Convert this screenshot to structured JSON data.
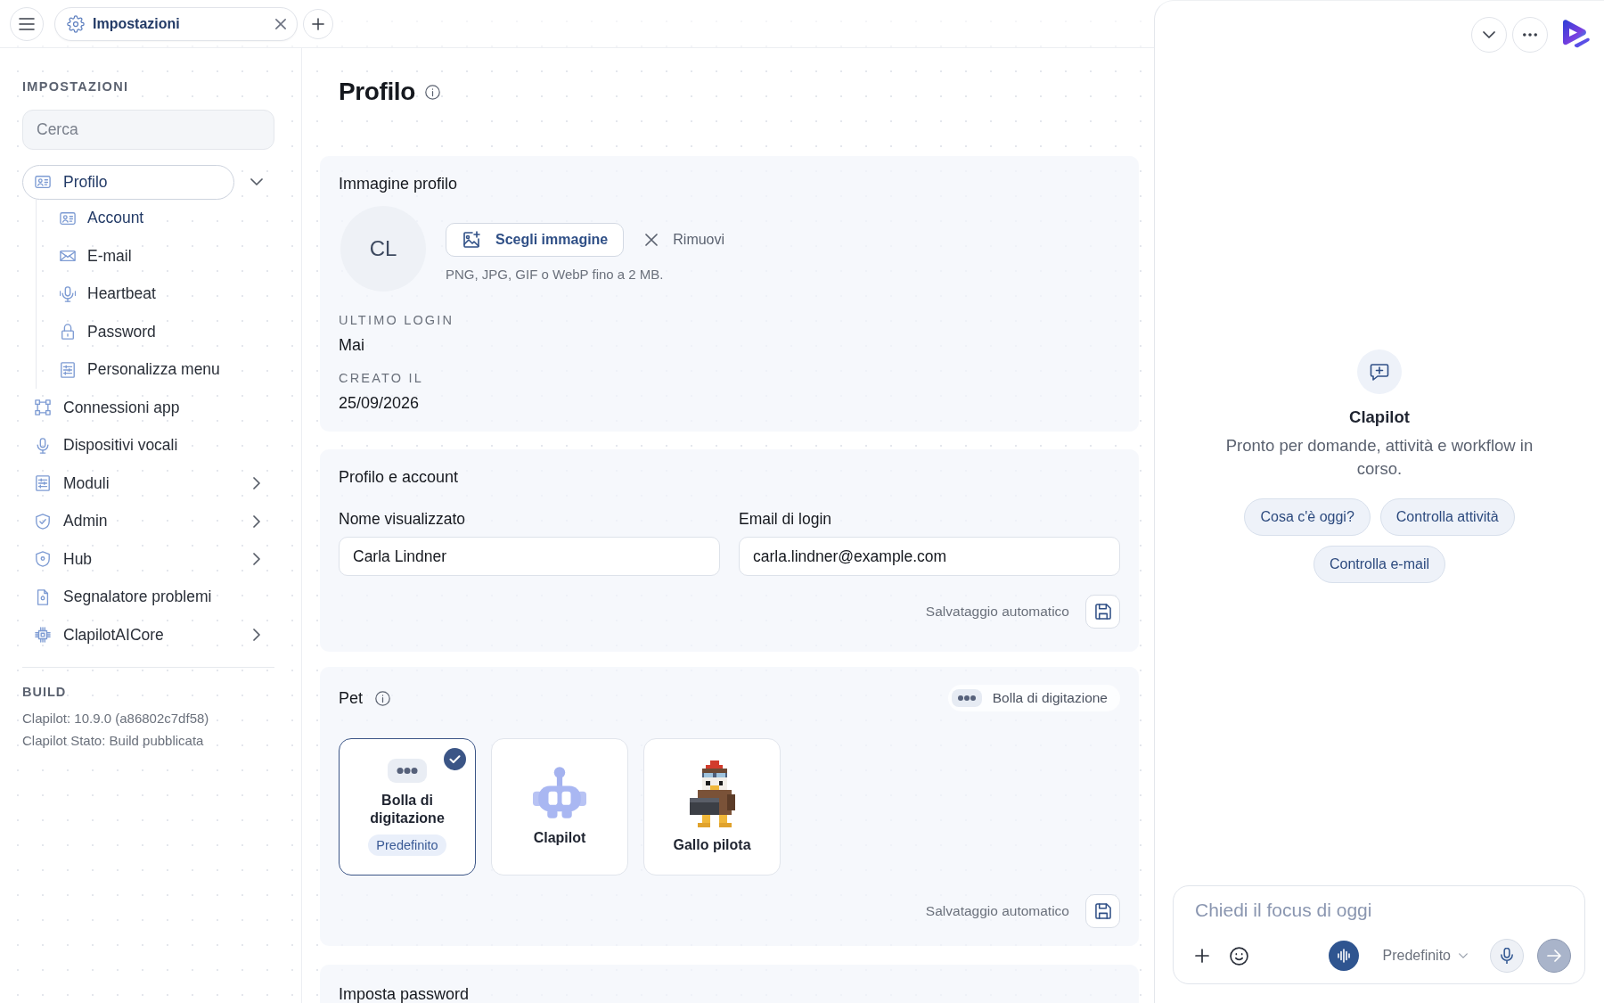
{
  "top_bar": {
    "tabs": [
      {
        "label": "Impostazioni",
        "selected": true
      }
    ]
  },
  "sidebar": {
    "title": "IMPOSTAZIONI",
    "search": {
      "placeholder": "Cerca"
    },
    "items": [
      {
        "label": "Profilo",
        "selected": true,
        "expanded": true,
        "children": [
          {
            "label": "Account",
            "selected": true
          },
          {
            "label": "E-mail",
            "selected": false
          },
          {
            "label": "Heartbeat",
            "selected": false
          },
          {
            "label": "Password",
            "selected": false
          },
          {
            "label": "Personalizza menu",
            "selected": false
          }
        ]
      },
      {
        "label": "Connessioni app",
        "selected": false
      },
      {
        "label": "Dispositivi vocali",
        "selected": false
      },
      {
        "label": "Moduli",
        "selected": false,
        "expanded": false
      },
      {
        "label": "Admin",
        "selected": false,
        "expanded": false
      },
      {
        "label": "Hub",
        "selected": false,
        "expanded": false
      },
      {
        "label": "Segnalatore problemi",
        "selected": false
      },
      {
        "label": "ClapilotAICore",
        "selected": false,
        "expanded": false
      }
    ],
    "build": {
      "title": "BUILD",
      "lines": [
        "Clapilot: 10.9.0 (a86802c7df58)",
        "Clapilot Stato: Build pubblicata"
      ]
    }
  },
  "page": {
    "title": "Profilo"
  },
  "profile_image": {
    "title": "Immagine profilo",
    "initials": "CL",
    "choose_button": "Scegli immagine",
    "remove_button": "Rimuovi",
    "hint": "PNG, JPG, GIF o WebP fino a 2 MB.",
    "details": [
      {
        "label": "ULTIMO LOGIN",
        "value": "Mai"
      },
      {
        "label": "CREATO IL",
        "value": "25/09/2026"
      }
    ]
  },
  "account": {
    "title": "Profilo e account",
    "fields": [
      {
        "label": "Nome visualizzato",
        "value": "Carla Lindner"
      },
      {
        "label": "Email di login",
        "value": "carla.lindner@example.com"
      }
    ],
    "autosave": "Salvataggio automatico"
  },
  "pet": {
    "title": "Pet",
    "current": "Bolla di digitazione",
    "options": [
      {
        "label": "Bolla di digitazione",
        "badge": "Predefinito",
        "selected": true
      },
      {
        "label": "Clapilot",
        "selected": false
      },
      {
        "label": "Gallo pilota",
        "selected": false
      }
    ],
    "autosave": "Salvataggio automatico"
  },
  "password": {
    "title": "Imposta password"
  },
  "assistant": {
    "name": "Clapilot",
    "description": "Pronto per domande, attività e workflow in corso.",
    "suggestions": [
      "Cosa c'è oggi?",
      "Controlla attività",
      "Controlla e-mail"
    ],
    "composer": {
      "placeholder": "Chiedi il focus di oggi",
      "model": "Predefinito",
      "send": {
        "disabled": true
      }
    }
  }
}
